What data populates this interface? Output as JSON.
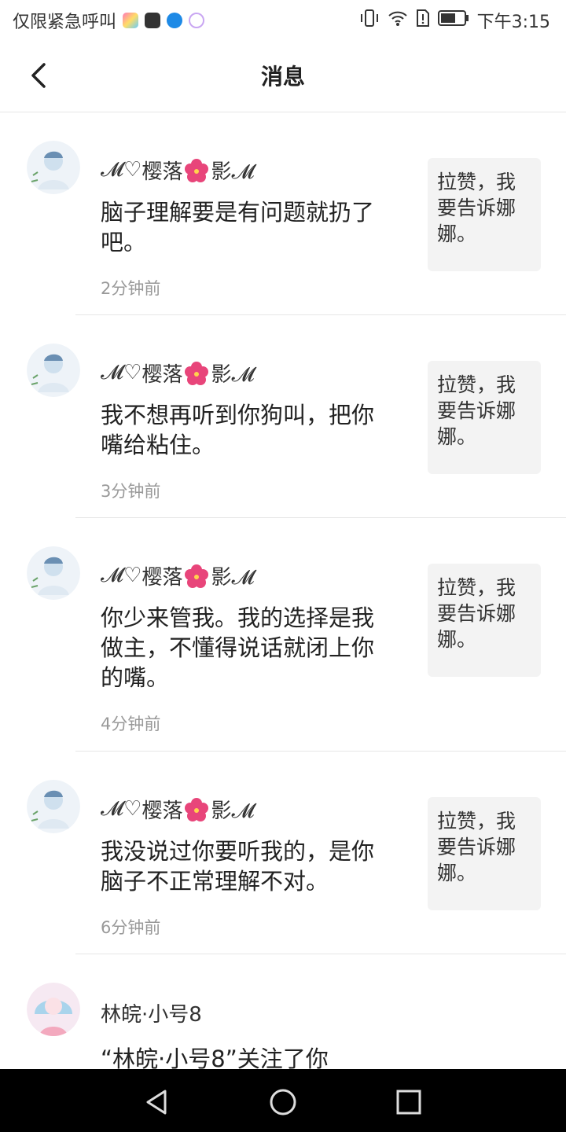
{
  "status_bar": {
    "left_text": "仅限紧急呼叫",
    "time": "下午3:15"
  },
  "header": {
    "title": "消息",
    "back_icon": "chevron-left-icon"
  },
  "messages": [
    {
      "user_prefix": "𝓜♡",
      "user_mid": "樱落",
      "user_suffix": "影𝓜",
      "text": "脑子理解要是有问题就扔了吧。",
      "time": "2分钟前",
      "reply": "拉赞，我要告诉娜娜。"
    },
    {
      "user_prefix": "𝓜♡",
      "user_mid": "樱落",
      "user_suffix": "影𝓜",
      "text": "我不想再听到你狗叫，把你嘴给粘住。",
      "time": "3分钟前",
      "reply": "拉赞，我要告诉娜娜。"
    },
    {
      "user_prefix": "𝓜♡",
      "user_mid": "樱落",
      "user_suffix": "影𝓜",
      "text": "你少来管我。我的选择是我做主，不懂得说话就闭上你的嘴。",
      "time": "4分钟前",
      "reply": "拉赞，我要告诉娜娜。"
    },
    {
      "user_prefix": "𝓜♡",
      "user_mid": "樱落",
      "user_suffix": "影𝓜",
      "text": "我没说过你要听我的，是你脑子不正常理解不对。",
      "time": "6分钟前",
      "reply": "拉赞，我要告诉娜娜。"
    }
  ],
  "follow": {
    "name": "林皖·小号8",
    "text": "“林皖·小号8”关注了你"
  },
  "colors": {
    "reply_bg": "#f3f3f3",
    "time_text": "#999999",
    "divider": "#e6e6e6"
  }
}
